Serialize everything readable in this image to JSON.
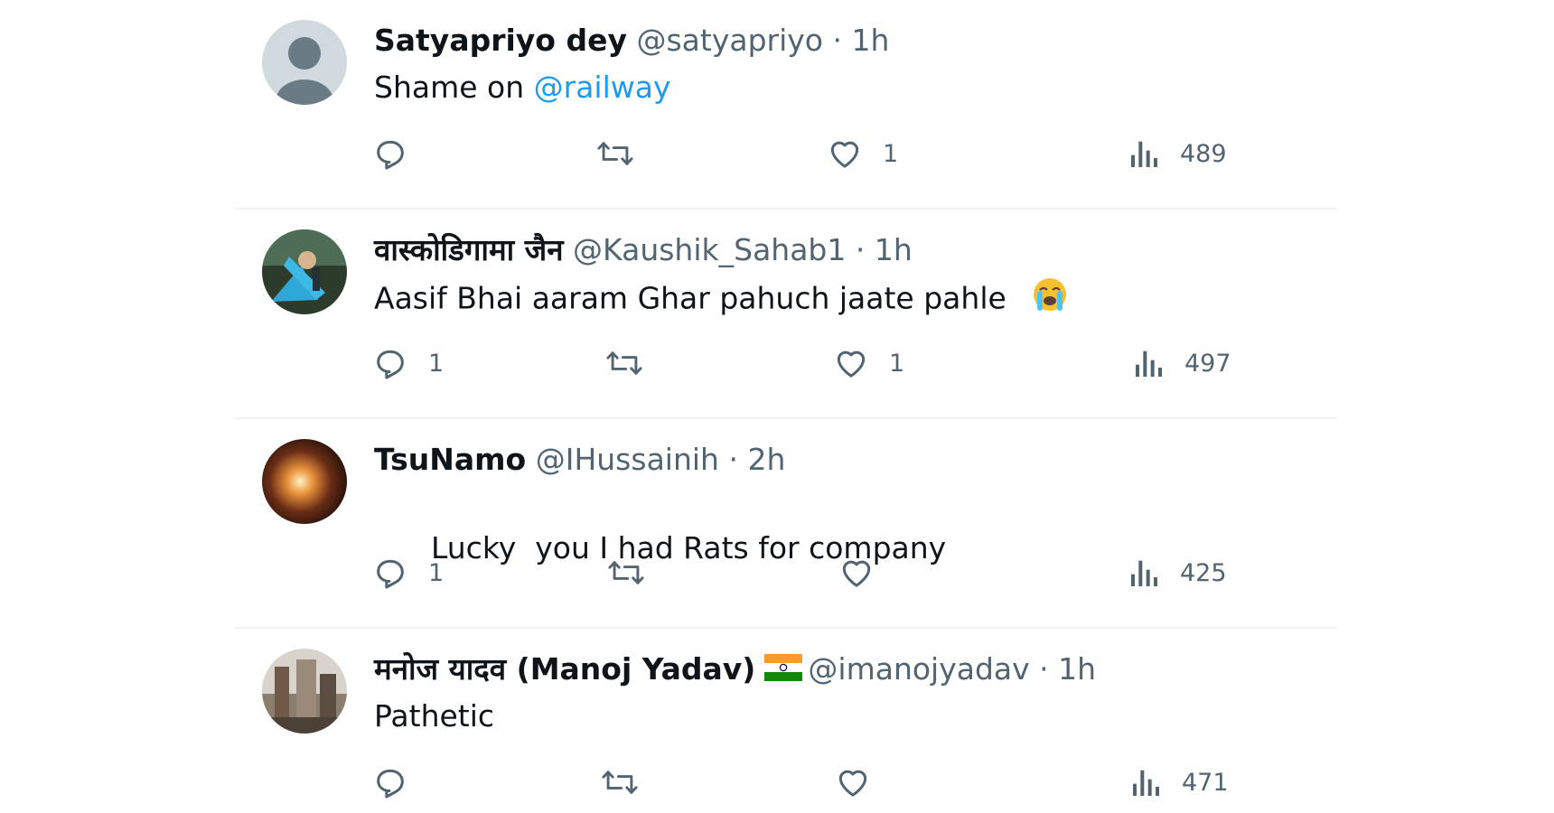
{
  "colors": {
    "name": "#0f1419",
    "secondary": "#536471",
    "mention": "#1d9bf0",
    "divider": "#eff3f4"
  },
  "icons": [
    "reply-icon",
    "retweet-icon",
    "like-icon",
    "views-icon"
  ],
  "tweets": [
    {
      "name": "Satyapriyo dey",
      "handle": "@satyapriyo",
      "separator": "·",
      "time": "1h",
      "text": "Shame on ",
      "mention": "@railway",
      "reply_count": "",
      "retweet_count": "",
      "like_count": "1",
      "views": "489",
      "avatar": "default-avatar"
    },
    {
      "name": "वास्कोडिगामा जैन",
      "handle": "@Kaushik_Sahab1",
      "separator": "·",
      "time": "1h",
      "text": "Aasif Bhai aaram Ghar pahuch jaate pahle",
      "emoji": "crying-face-emoji",
      "reply_count": "1",
      "retweet_count": "",
      "like_count": "1",
      "views": "497",
      "avatar": "photo-avatar"
    },
    {
      "name": "TsuNamo",
      "handle": "@IHussainih",
      "separator": "·",
      "time": "2h",
      "text": "Lucky  you I had Rats for company",
      "reply_count": "1",
      "retweet_count": "",
      "like_count": "",
      "views": "425",
      "avatar": "photo-avatar"
    },
    {
      "name": "मनोज यादव (Manoj Yadav)",
      "flag": "india-flag-emoji",
      "handle": "@imanojyadav",
      "separator": "·",
      "time": "1h",
      "text": "Pathetic",
      "reply_count": "",
      "retweet_count": "",
      "like_count": "",
      "views": "471",
      "avatar": "photo-avatar"
    }
  ]
}
